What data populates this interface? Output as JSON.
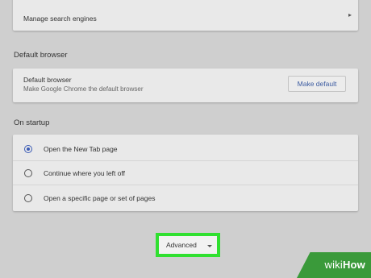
{
  "search": {
    "manage_engines_label": "Manage search engines"
  },
  "default_browser": {
    "section_title": "Default browser",
    "row_title": "Default browser",
    "row_subtitle": "Make Google Chrome the default browser",
    "button_label": "Make default"
  },
  "on_startup": {
    "section_title": "On startup",
    "options": [
      {
        "label": "Open the New Tab page",
        "selected": true
      },
      {
        "label": "Continue where you left off",
        "selected": false
      },
      {
        "label": "Open a specific page or set of pages",
        "selected": false
      }
    ]
  },
  "advanced": {
    "label": "Advanced",
    "highlight_color": "#30e030"
  },
  "watermark": {
    "part1": "wiki",
    "part2": "How",
    "color": "#3a9a3a"
  }
}
